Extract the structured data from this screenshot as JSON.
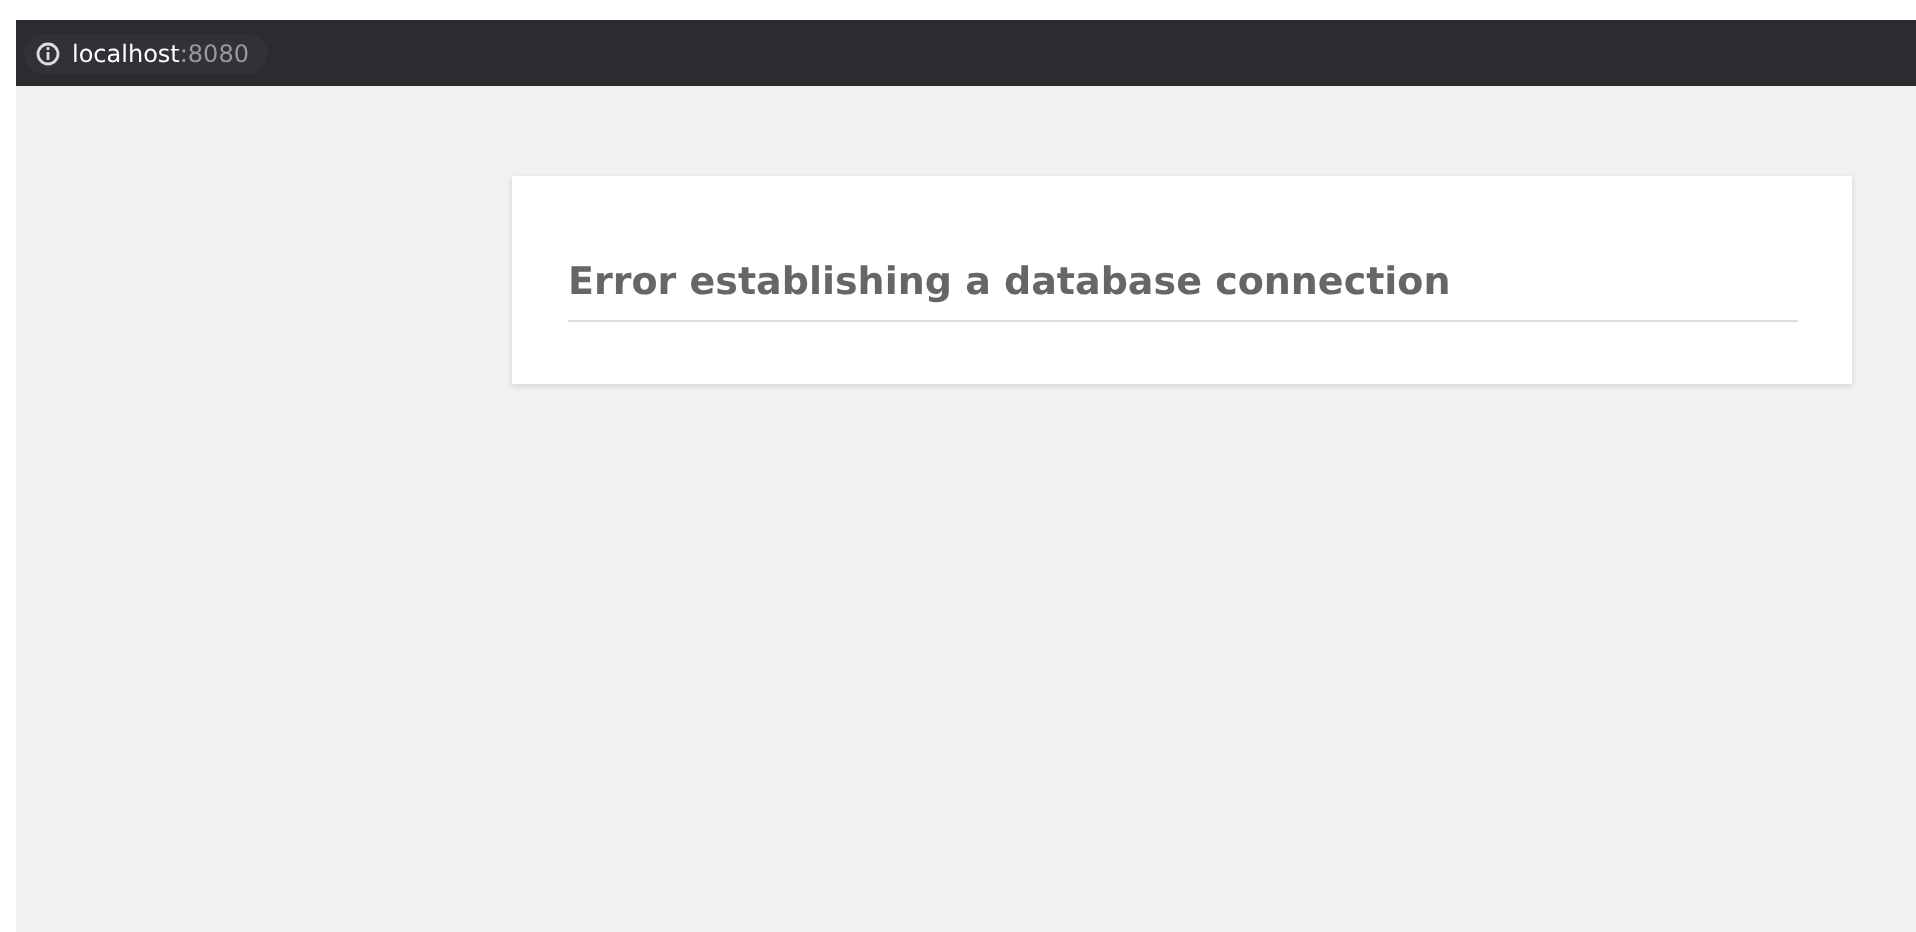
{
  "address_bar": {
    "host": "localhost",
    "port": ":8080"
  },
  "error": {
    "heading": "Error establishing a database connection"
  }
}
